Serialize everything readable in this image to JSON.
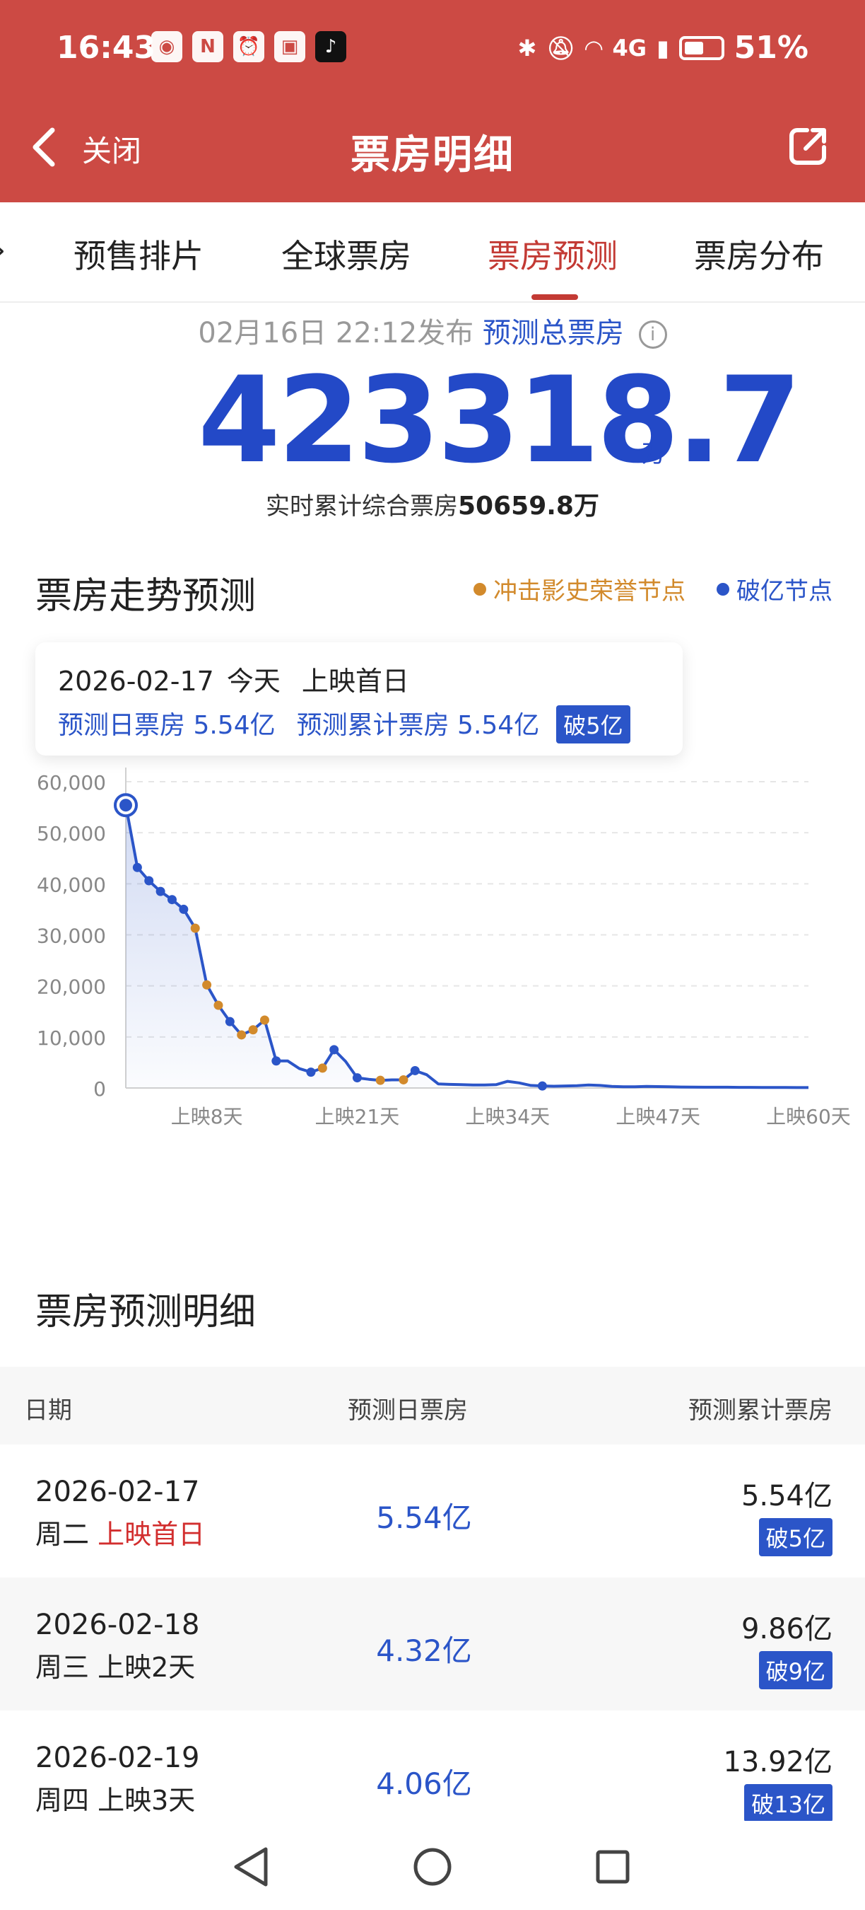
{
  "status": {
    "time": "16:43",
    "network": "4G",
    "battery": "51%"
  },
  "nav": {
    "close_label": "关闭",
    "title": "票房明细"
  },
  "tabs": [
    {
      "label": "预售排片"
    },
    {
      "label": "全球票房"
    },
    {
      "label": "票房预测"
    },
    {
      "label": "票房分布"
    }
  ],
  "summary": {
    "publish_time": "02月16日 22:12发布",
    "predict_label": "预测总票房",
    "total": "423318.7",
    "unit": "万",
    "realtime_label": "实时累计综合票房",
    "realtime_value": "50659.8万"
  },
  "trend": {
    "title": "票房走势预测",
    "legend_orange": "冲击影史荣誉节点",
    "legend_blue": "破亿节点",
    "tooltip": {
      "date": "2026-02-17",
      "today": "今天",
      "day_label": "上映首日",
      "daily": "预测日票房 5.54亿",
      "cumulative": "预测累计票房 5.54亿",
      "badge": "破5亿"
    }
  },
  "chart_data": {
    "type": "line",
    "title": "",
    "xlabel": "",
    "ylabel": "",
    "ylim": [
      0,
      60000
    ],
    "yticks": [
      "60,000",
      "50,000",
      "40,000",
      "30,000",
      "20,000",
      "10,000",
      "0"
    ],
    "xticks": [
      "上映8天",
      "上映21天",
      "上映34天",
      "上映47天",
      "上映60天"
    ],
    "xtick_days": [
      8,
      21,
      34,
      47,
      60
    ],
    "grid": true,
    "legend": "top-right",
    "colors": {
      "line": "#2b55c8",
      "orange": "#d28a2c",
      "blue": "#2b55c8"
    },
    "x": [
      1,
      2,
      3,
      4,
      5,
      6,
      7,
      8,
      9,
      10,
      11,
      12,
      13,
      14,
      15,
      16,
      17,
      18,
      19,
      20,
      21,
      22,
      23,
      24,
      25,
      26,
      27,
      28,
      29,
      30,
      31,
      32,
      33,
      34,
      35,
      36,
      37,
      38,
      39,
      40,
      41,
      42,
      43,
      44,
      45,
      46,
      47,
      48,
      49,
      50,
      51,
      52,
      53,
      54,
      55,
      56,
      57,
      58,
      59,
      60
    ],
    "values": [
      55400,
      43200,
      40600,
      38500,
      36900,
      35000,
      31300,
      20200,
      16200,
      13000,
      10400,
      11400,
      13300,
      5300,
      5300,
      3800,
      3100,
      3900,
      7500,
      5200,
      2000,
      1700,
      1500,
      1600,
      1600,
      3400,
      2600,
      800,
      700,
      650,
      600,
      600,
      650,
      1300,
      1000,
      500,
      400,
      350,
      400,
      450,
      600,
      500,
      300,
      250,
      250,
      300,
      280,
      250,
      200,
      180,
      150,
      150,
      150,
      130,
      120,
      110,
      100,
      100,
      90,
      80
    ],
    "markers": [
      {
        "day": 1,
        "type": "blue"
      },
      {
        "day": 2,
        "type": "blue"
      },
      {
        "day": 3,
        "type": "blue"
      },
      {
        "day": 4,
        "type": "blue"
      },
      {
        "day": 5,
        "type": "blue"
      },
      {
        "day": 6,
        "type": "blue"
      },
      {
        "day": 7,
        "type": "orange"
      },
      {
        "day": 8,
        "type": "orange"
      },
      {
        "day": 9,
        "type": "orange"
      },
      {
        "day": 10,
        "type": "blue"
      },
      {
        "day": 11,
        "type": "orange"
      },
      {
        "day": 12,
        "type": "orange"
      },
      {
        "day": 13,
        "type": "orange"
      },
      {
        "day": 14,
        "type": "blue"
      },
      {
        "day": 17,
        "type": "blue"
      },
      {
        "day": 18,
        "type": "orange"
      },
      {
        "day": 19,
        "type": "blue"
      },
      {
        "day": 21,
        "type": "blue"
      },
      {
        "day": 23,
        "type": "orange"
      },
      {
        "day": 25,
        "type": "orange"
      },
      {
        "day": 26,
        "type": "blue"
      },
      {
        "day": 37,
        "type": "blue"
      }
    ],
    "highlight_day": 1
  },
  "detail": {
    "title": "票房预测明细",
    "columns": [
      "日期",
      "预测日票房",
      "预测累计票房"
    ],
    "rows": [
      {
        "date": "2026-02-17",
        "weekday": "周二",
        "day": "上映首日",
        "daily": "5.54亿",
        "cum": "5.54亿",
        "badge": "破5亿"
      },
      {
        "date": "2026-02-18",
        "weekday": "周三",
        "day": "上映2天",
        "daily": "4.32亿",
        "cum": "9.86亿",
        "badge": "破9亿"
      },
      {
        "date": "2026-02-19",
        "weekday": "周四",
        "day": "上映3天",
        "daily": "4.06亿",
        "cum": "13.92亿",
        "badge": "破13亿"
      }
    ]
  }
}
